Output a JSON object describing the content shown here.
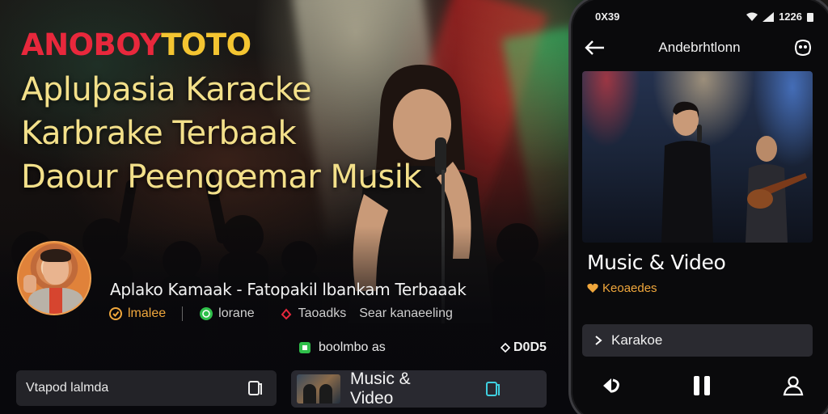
{
  "banner": {
    "brand_part1": "ANOBOY",
    "brand_part2": "TOTO",
    "headline_lines": [
      "Apluþasia Karacke",
      "Karbrake Terbaak",
      "Daour Peengœmar Musik"
    ]
  },
  "app_info": {
    "title": "Aplako  Kamaak - Fatopakil lbankam Terbaaak",
    "meta": [
      {
        "icon": "star-badge-icon",
        "label": "lmalee"
      },
      {
        "icon": "whatsapp-icon",
        "label": "lorane"
      },
      {
        "icon": "play-arrow-icon",
        "label": "Taoadks"
      },
      {
        "icon": "",
        "label": "Sear kanaeeling"
      }
    ]
  },
  "stats": {
    "left_label": "boolmbo as",
    "right_label": "D0D5"
  },
  "bottom_bars": {
    "left_label": "Vtapod lalmda",
    "mid_label": "Music & Video"
  },
  "phone": {
    "status_time": "0X39",
    "status_right": "1226",
    "header_title": "Andebrhtlonn",
    "video_title": "Music & Video",
    "video_subtitle": "Keoaedes",
    "list_item_label": "Karakoe"
  },
  "colors": {
    "brand_red": "#e8283c",
    "brand_yellow": "#f4c531",
    "headline": "#f3e08a",
    "accent_orange": "#f0a73c",
    "accent_cyan": "#3fd0e0",
    "accent_green": "#2fbf4a"
  }
}
